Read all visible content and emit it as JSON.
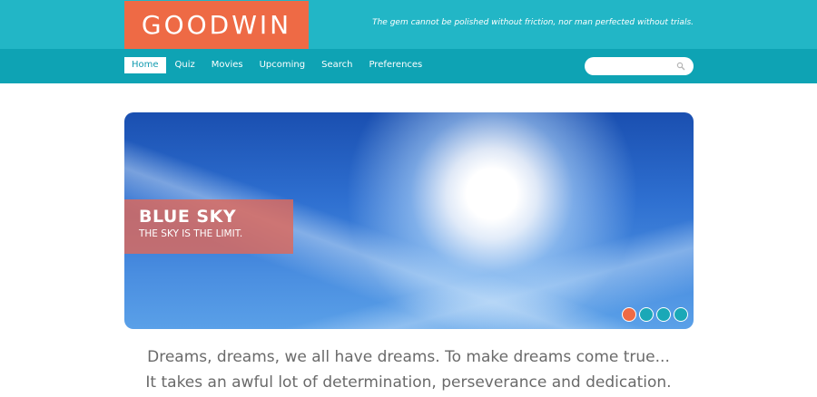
{
  "header": {
    "logo_text": "GOODWIN",
    "tagline": "The gem cannot be polished without friction, nor man perfected without trials."
  },
  "nav": {
    "items": [
      {
        "label": "Home",
        "active": true
      },
      {
        "label": "Quiz"
      },
      {
        "label": "Movies"
      },
      {
        "label": "Upcoming"
      },
      {
        "label": "Search"
      },
      {
        "label": "Preferences"
      }
    ]
  },
  "search": {
    "placeholder": "",
    "icon": "search-icon"
  },
  "slider": {
    "title": "BLUE SKY",
    "subtitle": "THE SKY IS THE LIMIT.",
    "slides_count": 4,
    "active_slide": 1
  },
  "intro": {
    "line1": "Dreams, dreams, we all have dreams. To make dreams come true...",
    "line2": "It takes an awful lot of determination, perseverance and dedication."
  },
  "colors": {
    "header_bg": "#22b6c6",
    "nav_bg": "#0ea3b4",
    "accent": "#ee6a45"
  }
}
